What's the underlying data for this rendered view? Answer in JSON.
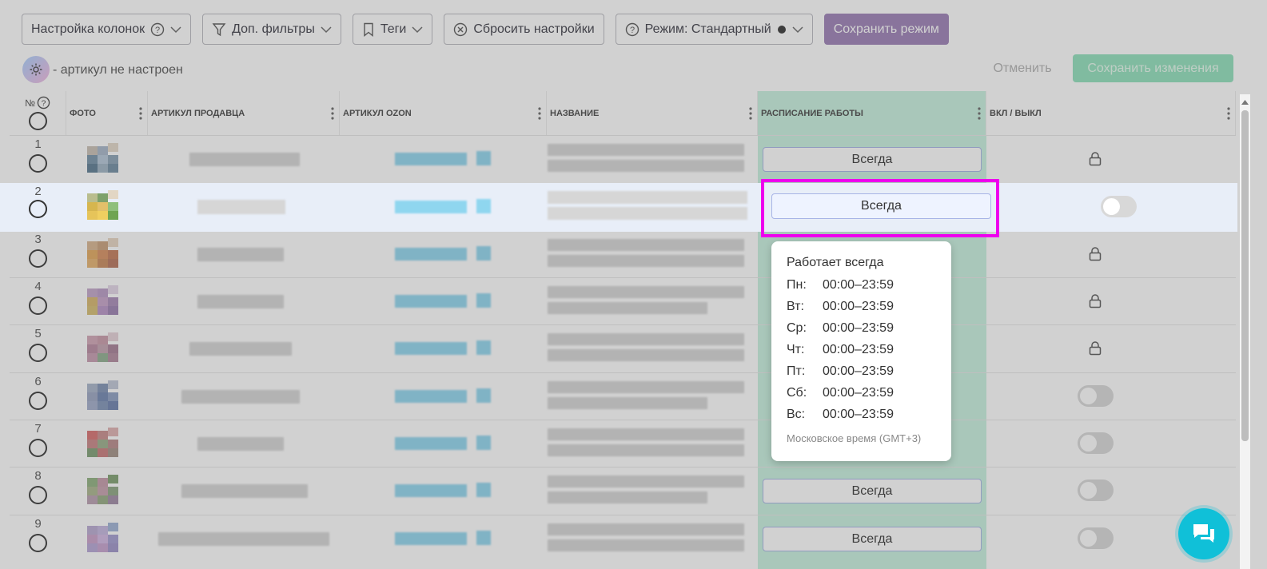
{
  "toolbar": {
    "columns_label": "Настройка колонок",
    "filters_label": "Доп. фильтры",
    "tags_label": "Теги",
    "reset_label": "Сбросить настройки",
    "mode_label": "Режим: Стандартный",
    "save_mode_label": "Сохранить режим"
  },
  "status": {
    "text": "- артикул не настроен",
    "cancel_label": "Отменить",
    "save_changes_label": "Сохранить изменения"
  },
  "headers": {
    "num": "№",
    "photo": "ФОТО",
    "seller_sku": "АРТИКУЛ ПРОДАВЦА",
    "ozon_sku": "АРТИКУЛ OZON",
    "name": "НАЗВАНИЕ",
    "schedule": "РАСПИСАНИЕ РАБОТЫ",
    "onoff": "ВКЛ / ВЫКЛ"
  },
  "rows": [
    {
      "num": "1",
      "schedule": "Всегда",
      "control": "lock-icon"
    },
    {
      "num": "2",
      "schedule": "Всегда",
      "control": "toggle"
    },
    {
      "num": "3",
      "schedule": "",
      "control": "lock-icon"
    },
    {
      "num": "4",
      "schedule": "",
      "control": "lock-icon"
    },
    {
      "num": "5",
      "schedule": "",
      "control": "lock-icon"
    },
    {
      "num": "6",
      "schedule": "",
      "control": "toggle"
    },
    {
      "num": "7",
      "schedule": "",
      "control": "toggle"
    },
    {
      "num": "8",
      "schedule": "Всегда",
      "control": "toggle"
    },
    {
      "num": "9",
      "schedule": "Всегда",
      "control": "toggle"
    }
  ],
  "popup": {
    "title": "Работает всегда",
    "days": [
      {
        "day": "Пн:",
        "hours": "00:00–23:59"
      },
      {
        "day": "Вт:",
        "hours": "00:00–23:59"
      },
      {
        "day": "Ср:",
        "hours": "00:00–23:59"
      },
      {
        "day": "Чт:",
        "hours": "00:00–23:59"
      },
      {
        "day": "Пт:",
        "hours": "00:00–23:59"
      },
      {
        "day": "Сб:",
        "hours": "00:00–23:59"
      },
      {
        "day": "Вс:",
        "hours": "00:00–23:59"
      }
    ],
    "timezone": "Московское время (GMT+3)"
  },
  "colors": {
    "highlight_border": "#ee00ee",
    "active_column": "#c8f2e0",
    "chat_button": "#10c0d8",
    "primary_button": "#9b7fb6"
  }
}
